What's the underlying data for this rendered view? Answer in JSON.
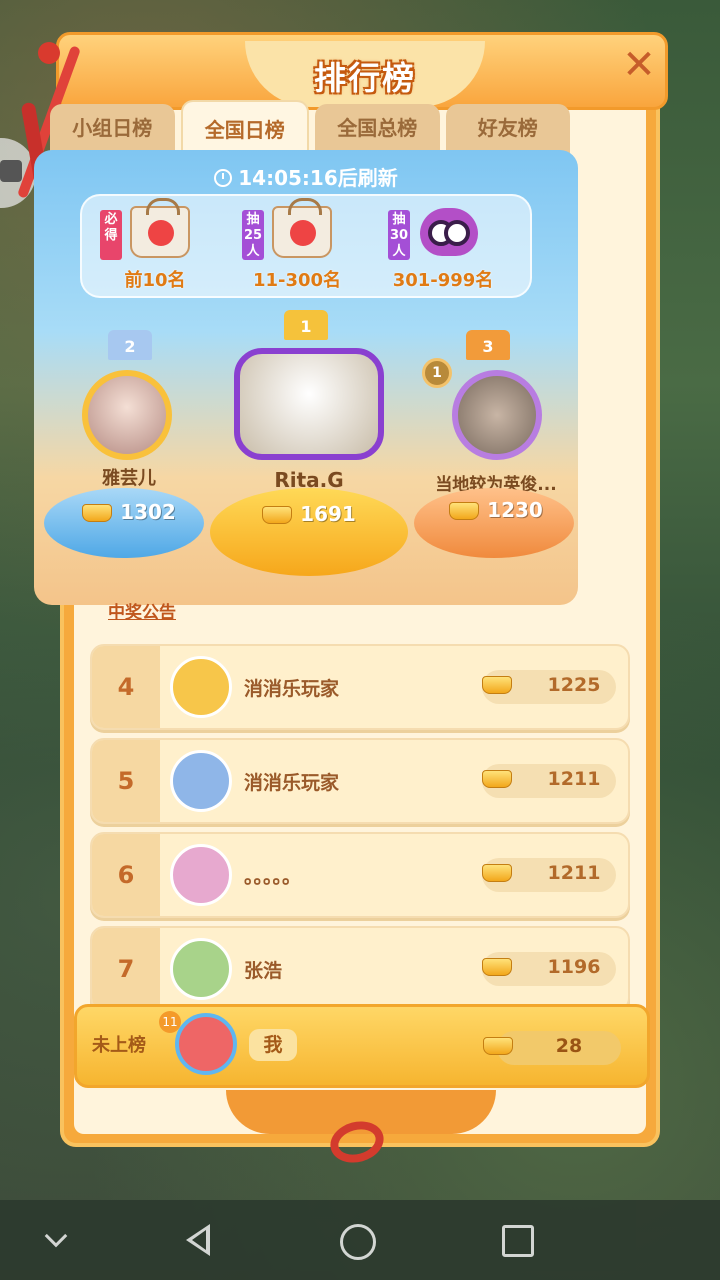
{
  "header": {
    "title": "排行榜",
    "close_glyph": "✕"
  },
  "tabs": [
    {
      "label": "小组日榜",
      "active": false
    },
    {
      "label": "全国日榜",
      "active": true
    },
    {
      "label": "全国总榜",
      "active": false
    },
    {
      "label": "好友榜",
      "active": false
    }
  ],
  "timer": {
    "text": "14:05:16后刷新"
  },
  "prizes": [
    {
      "tag": "必得",
      "range": "前10名",
      "item": "bag-icon"
    },
    {
      "tag": "抽25人",
      "range": "11-300名",
      "item": "bag-icon"
    },
    {
      "tag": "抽30人",
      "range": "301-999名",
      "item": "owl-plush-icon"
    }
  ],
  "podium": {
    "first": {
      "rank": "1",
      "name": "Rita.G",
      "score": "1691"
    },
    "second": {
      "rank": "2",
      "name": "雅芸儿",
      "score": "1302"
    },
    "third": {
      "rank": "3",
      "name": "当地较为英俊...",
      "score": "1230",
      "badge": "1"
    }
  },
  "notice_label": "中奖公告",
  "ranking": [
    {
      "rank": "4",
      "name": "消消乐玩家",
      "score": "1225"
    },
    {
      "rank": "5",
      "name": "消消乐玩家",
      "score": "1211"
    },
    {
      "rank": "6",
      "name": "。。。。。",
      "score": "1211"
    },
    {
      "rank": "7",
      "name": "张浩",
      "score": "1196"
    }
  ],
  "self": {
    "rank": "未上榜",
    "level": "11",
    "name": "我",
    "score": "28"
  },
  "colors": {
    "accent": "#f6a93c",
    "panel": "#fff4dc",
    "rank_text": "#c46a2a"
  }
}
